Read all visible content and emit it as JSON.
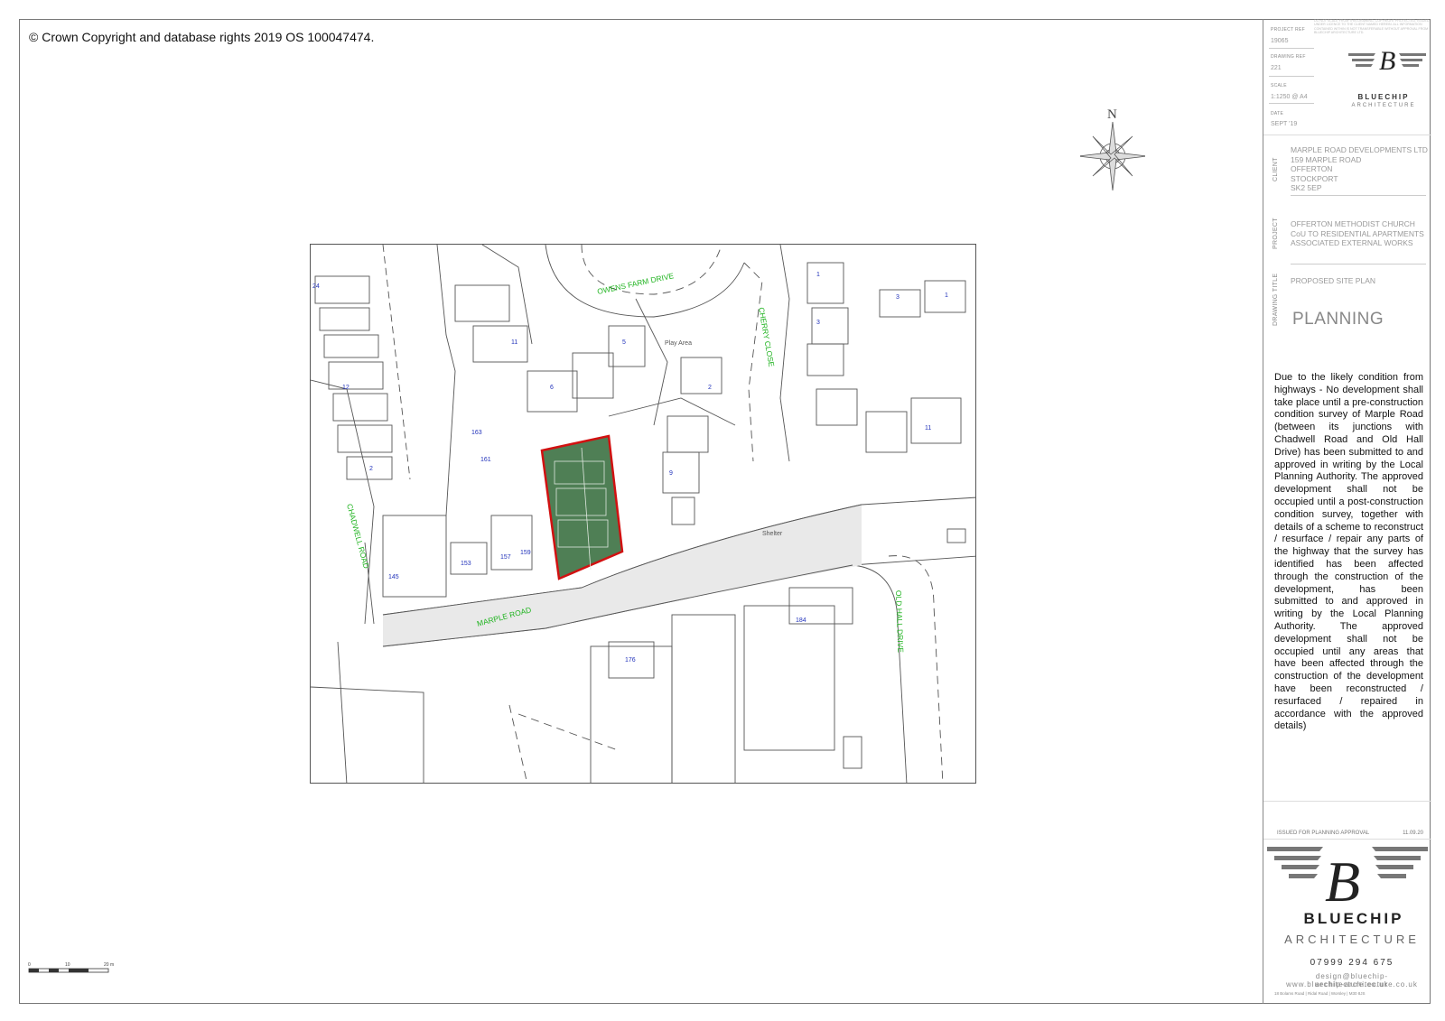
{
  "copyright": "© Crown Copyright and database rights 2019 OS 100047474.",
  "title_block": {
    "project_ref_label": "PROJECT REF",
    "project_ref": "19065",
    "drawing_ref_label": "DRAWING REF",
    "drawing_ref": "221",
    "scale_label": "SCALE",
    "scale": "1:1250 @ A4",
    "date_label": "DATE",
    "date": "SEPT '19",
    "client_label": "CLIENT",
    "client_lines": [
      "MARPLE ROAD DEVELOPMENTS LTD",
      "159 MARPLE ROAD",
      "OFFERTON",
      "STOCKPORT",
      "SK2 5EP"
    ],
    "project_label": "PROJECT",
    "project_lines": [
      "OFFERTON METHODIST CHURCH",
      "CoU TO RESIDENTIAL APARTMENTS",
      "ASSOCIATED EXTERNAL WORKS"
    ],
    "drawing_title_label": "DRAWING TITLE",
    "drawing_title": "PROPOSED SITE PLAN",
    "status": "PLANNING",
    "note": "Due to the likely condition from highways - No development shall take place until a pre-construction condition survey of Marple Road (between its junctions with Chadwell Road and Old Hall Drive) has been submitted to and approved in writing by the Local Planning Authority. The approved development shall not be occupied until a post-construction condition survey, together with details of a scheme to reconstruct / resurface / repair any parts of the highway that the survey has identified has been affected through the construction of the development, has been submitted to and approved in writing by the Local Planning Authority. The approved development shall not be occupied until any areas that have been affected through the construction of the development have been reconstructed / resurfaced / repaired in accordance with the approved details)",
    "revision_text": "ISSUED FOR PLANNING APPROVAL",
    "revision_date": "11.09.20",
    "disclaimer": "DO NOT SCALE FROM THIS DRAWING. COPYRIGHT PROTECTED. ISSUED UNDER LICENCE TO THE CLIENT NAMED HEREIN. ALL INFORMATION CONTAINED WITHIN IS NOT TRANSFERABLE WITHOUT APPROVAL FROM BLUECHIP ARCHITECTURE LTD."
  },
  "brand": {
    "name": "BLUECHIP",
    "sub": "ARCHITECTURE",
    "monogram": "B",
    "phone": "07999 294 675",
    "email": "design@bluechip-architecture.co.uk",
    "web": "www.bluechip-architecture.co.uk",
    "address": "18 Bolams Road  |  Ridal Road  |  Worsley  |  M30 8JS"
  },
  "north_label": "N",
  "scale_bar": {
    "labels": [
      "0",
      "10",
      "20 m"
    ]
  },
  "map": {
    "streets": [
      "OWENS FARM DRIVE",
      "CHERRY CLOSE",
      "CHADWELL ROAD",
      "MARPLE ROAD",
      "OLD HALL DRIVE"
    ],
    "labels": [
      "Play Area",
      "Shelter"
    ],
    "house_numbers": [
      "24",
      "12",
      "2",
      "163",
      "161",
      "11",
      "5",
      "6",
      "2",
      "9",
      "145",
      "153",
      "157",
      "159",
      "176",
      "184",
      "1",
      "3",
      "3",
      "1",
      "11"
    ]
  },
  "colors": {
    "street_label": "#21b421",
    "house_number": "#2233bb",
    "site_boundary": "#d11111",
    "site_fill": "#4f7f55"
  }
}
